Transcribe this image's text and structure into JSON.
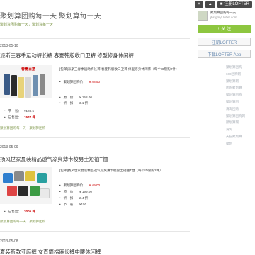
{
  "topbar": {
    "menu_label": "+",
    "home_label": "",
    "login_label": "注册LOFTER"
  },
  "blog": {
    "title": "聚划算团购每一天 聚划算每一天",
    "subtitle": "聚划算团购每一天，聚划算每一天"
  },
  "panel": {
    "name": "聚划算团购每一天",
    "url": "jhstgmyt.lofter.com",
    "follow_label": "关 注",
    "register_label": "注册LOFTER",
    "download_label": "下载LOFTER App",
    "tags": [
      "聚划算团购",
      "600团购网",
      "聚划算网",
      "团购聚划算",
      "聚划算团购",
      "聚划算团",
      "海淘团购",
      "聚划算团购网",
      "聚划算网",
      "海淘",
      "天猫聚划算",
      "聚划"
    ]
  },
  "posts": [
    {
      "date": "2013-05-10",
      "title": "派斯王春季运动裤长裤 春夏韩版收口卫裤 修型修身休闲裤",
      "desc": "[包邮]派斯王春季运动裤长裤 春夏韩版收口卫裤 修型修身休闲裤（每个ID限购2件）",
      "group_price_label": "聚划算团购价：",
      "group_price": "¥ 48.50",
      "orig_label": "原　价：",
      "orig_price": "¥ 158.00",
      "discount_label": "折　扣：",
      "discount": "3.1 折",
      "save_label": "节　省：",
      "save": "¥108.5",
      "sold_label": "已售出：",
      "sold": "1547 件",
      "meta": "聚划算团购每一天　聚划算团购"
    },
    {
      "date": "2013-05-09",
      "title": "扬风世家夏装精品透气凉爽薄卡梭男士短袖T恤",
      "desc": "[包邮]扬风世家夏装精品透气凉爽薄卡梭男士短袖T恤（每个ID限购2件）",
      "group_price_label": "聚划算团购价：",
      "group_price": "¥ 49.00",
      "orig_label": "原　价：",
      "orig_price": "¥ 199.00",
      "discount_label": "折　扣：",
      "discount": "2.4 折",
      "save_label": "节　省：",
      "save": "¥150",
      "sold_label": "已售出：",
      "sold": "2005 件",
      "meta": "聚划算团购每一天　聚划算团购"
    },
    {
      "date": "2013-05-08",
      "title": "夏装新款亚麻裤 女直筒棉麻长裤中腰休闲裤"
    }
  ]
}
